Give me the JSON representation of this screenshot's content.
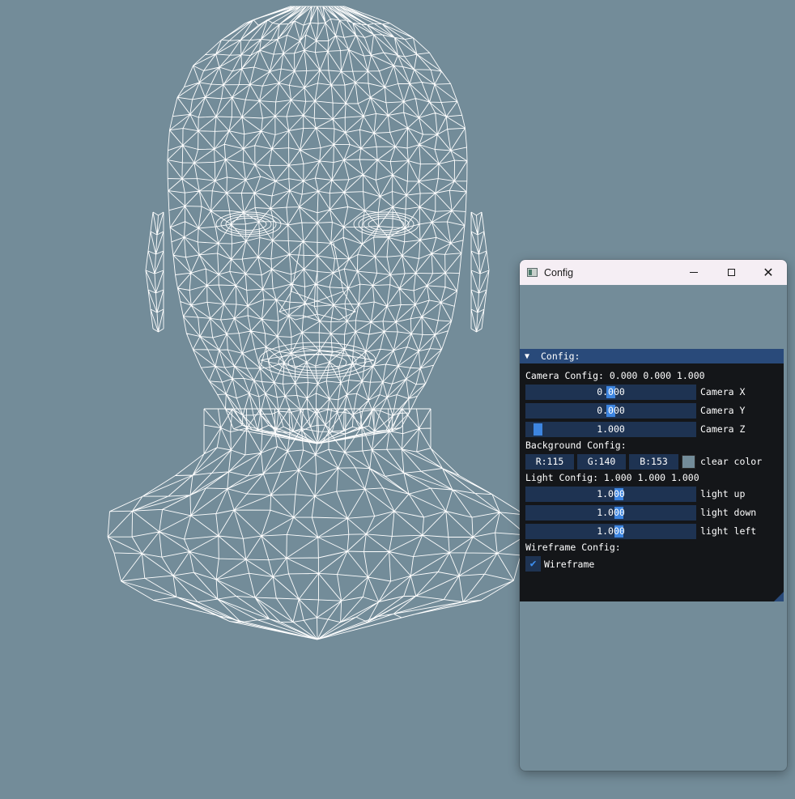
{
  "window": {
    "title": "Config"
  },
  "panel": {
    "header": "Config:",
    "camera": {
      "label": "Camera Config: 0.000 0.000 1.000",
      "sliders": [
        {
          "value_text": "0.000",
          "label": "Camera X",
          "fraction": 0.5
        },
        {
          "value_text": "0.000",
          "label": "Camera Y",
          "fraction": 0.5
        },
        {
          "value_text": "1.000",
          "label": "Camera Z",
          "fraction": 0.04
        }
      ]
    },
    "background": {
      "label": "Background Config:",
      "r": "R:115",
      "g": "G:140",
      "b": "B:153",
      "clear_label": "clear color",
      "color": "#738c99"
    },
    "light": {
      "label": "Light Config: 1.000 1.000 1.000",
      "sliders": [
        {
          "value_text": "1.000",
          "label": "light up",
          "fraction": 0.55
        },
        {
          "value_text": "1.000",
          "label": "light down",
          "fraction": 0.55
        },
        {
          "value_text": "1.000",
          "label": "light left",
          "fraction": 0.55
        }
      ]
    },
    "wireframe": {
      "label": "Wireframe Config:",
      "checkbox_label": "Wireframe",
      "checked": true
    }
  },
  "colors": {
    "background": "#738c99",
    "wire": "#ffffff",
    "panel_bg": "#141619",
    "header_bg": "#294a7a",
    "frame_bg": "#1e3352",
    "accent": "#3d85e0"
  }
}
